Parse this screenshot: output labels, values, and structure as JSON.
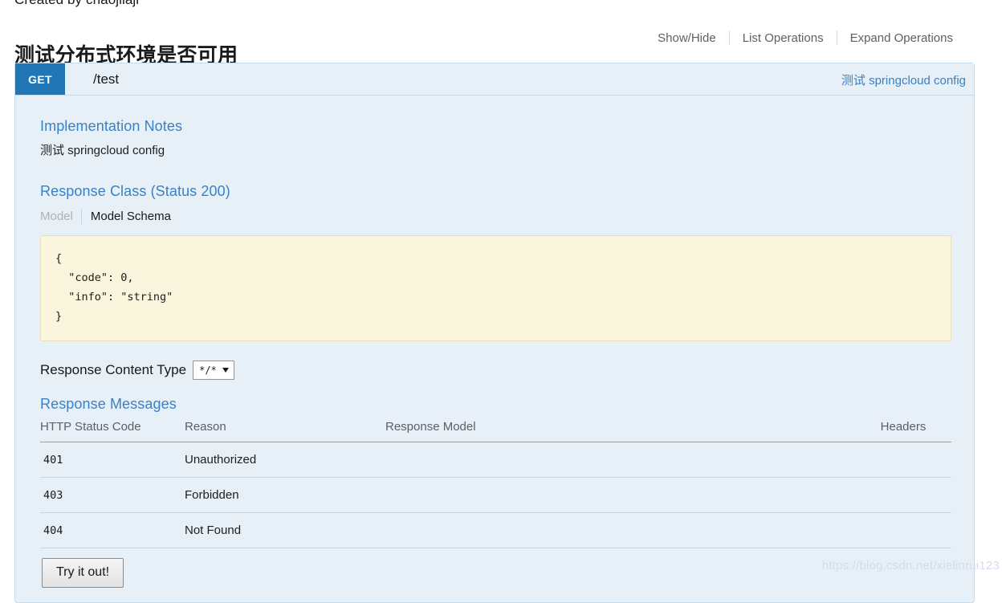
{
  "page": {
    "created_by": "Created by chaojilaji",
    "watermark": "https://blog.csdn.net/xielinrui123"
  },
  "resource": {
    "title": "测试分布式环境是否可用",
    "options": [
      {
        "label": "Show/Hide"
      },
      {
        "label": "List Operations"
      },
      {
        "label": "Expand Operations"
      }
    ]
  },
  "operation": {
    "method": "GET",
    "path": "/test",
    "summary": "测试 springcloud config",
    "implementation_notes": {
      "title": "Implementation Notes",
      "text": "测试 springcloud config"
    },
    "response_class": {
      "title": "Response Class (Status 200)",
      "tabs": [
        {
          "label": "Model",
          "active": false
        },
        {
          "label": "Model Schema",
          "active": true
        }
      ],
      "schema": "{\n  \"code\": 0,\n  \"info\": \"string\"\n}"
    },
    "content_type": {
      "label": "Response Content Type",
      "selected": "*/*",
      "options": [
        "*/*"
      ]
    },
    "response_messages": {
      "title": "Response Messages",
      "columns": [
        "HTTP Status Code",
        "Reason",
        "Response Model",
        "Headers"
      ],
      "rows": [
        {
          "code": "401",
          "reason": "Unauthorized",
          "model": "",
          "headers": ""
        },
        {
          "code": "403",
          "reason": "Forbidden",
          "model": "",
          "headers": ""
        },
        {
          "code": "404",
          "reason": "Not Found",
          "model": "",
          "headers": ""
        }
      ]
    },
    "try_it_out_label": "Try it out!"
  },
  "colors": {
    "method_get": "#2176b6",
    "panel_bg": "#e7f0f7",
    "panel_border": "#c3d9ec",
    "link": "#3b80c4",
    "schema_bg": "#faf5dd"
  }
}
